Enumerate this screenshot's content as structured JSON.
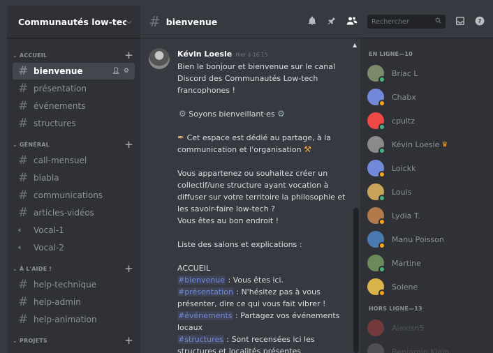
{
  "server": {
    "name": "Communautés low-tech f..."
  },
  "categories": [
    {
      "name": "ACCUEIL",
      "channels": [
        {
          "name": "bienvenue",
          "type": "text",
          "active": true
        },
        {
          "name": "présentation",
          "type": "text"
        },
        {
          "name": "événements",
          "type": "text"
        },
        {
          "name": "structures",
          "type": "text"
        }
      ]
    },
    {
      "name": "GÉNÉRAL",
      "channels": [
        {
          "name": "call-mensuel",
          "type": "text"
        },
        {
          "name": "blabla",
          "type": "text"
        },
        {
          "name": "communications",
          "type": "text"
        },
        {
          "name": "articles-vidéos",
          "type": "text"
        },
        {
          "name": "Vocal-1",
          "type": "voice"
        },
        {
          "name": "Vocal-2",
          "type": "voice"
        }
      ]
    },
    {
      "name": "À L'AIDE !",
      "channels": [
        {
          "name": "help-technique",
          "type": "text"
        },
        {
          "name": "help-admin",
          "type": "text"
        },
        {
          "name": "help-animation",
          "type": "text"
        }
      ]
    },
    {
      "name": "PROJETS",
      "channels": []
    }
  ],
  "topbar": {
    "channel": "bienvenue",
    "search_placeholder": "Rechercher"
  },
  "message": {
    "author": "Kévin Loesle",
    "time": "Hier à 16:15",
    "p1": "Bien le bonjour et bienvenue sur le canal Discord des Communautés Low-tech francophones !",
    "p2": "Soyons bienveillant·es",
    "p3": "Cet espace est dédié au partage, à la communication et l'organisation",
    "p4a": "Vous appartenez ou souhaitez créer un collectif/une structure ayant vocation à diffuser sur votre territoire la philosophie et les savoir-faire low-tech ?",
    "p4b": "Vous êtes au bon endroit !",
    "p5": "Liste des salons et explications :",
    "section": "ACCUEIL",
    "l1_mention": "#bienvenue",
    "l1_text": " : Vous êtes ici.",
    "l2_mention": "#présentation",
    "l2_text": " : N'hésitez pas à vous présenter, dire ce qui vous fait vibrer !",
    "l3_mention": "#événements",
    "l3_text": " : Partagez vos événements locaux",
    "l4_mention": "#structures",
    "l4_text": " : Sont recensées ici les structures et localités présentes"
  },
  "members": {
    "online_label": "EN LIGNE—10",
    "offline_label": "HORS LIGNE—13",
    "online": [
      {
        "name": "Briac L",
        "color": "#7a8a6a",
        "status": "#43b581"
      },
      {
        "name": "Chabx",
        "color": "#7289da",
        "status": "#faa61a"
      },
      {
        "name": "cpultz",
        "color": "#f04747",
        "status": "#43b581"
      },
      {
        "name": "Kévin Loesle",
        "color": "#8a8a8a",
        "status": "#43b581",
        "owner": true
      },
      {
        "name": "Loickk",
        "color": "#7289da",
        "status": "#faa61a"
      },
      {
        "name": "Louis",
        "color": "#c9a35a",
        "status": "#43b581"
      },
      {
        "name": "Lydia T.",
        "color": "#b07a4a",
        "status": "#faa61a"
      },
      {
        "name": "Manu Poisson",
        "color": "#4a7ab0",
        "status": "#faa61a"
      },
      {
        "name": "Martine",
        "color": "#6a8a5a",
        "status": "#43b581"
      },
      {
        "name": "Solene",
        "color": "#d9b24a",
        "status": "#faa61a"
      }
    ],
    "offline": [
      {
        "name": "Alexisn5",
        "color": "#f04747"
      },
      {
        "name": "Benjamin Klein",
        "color": "#8a8a8a"
      }
    ]
  }
}
